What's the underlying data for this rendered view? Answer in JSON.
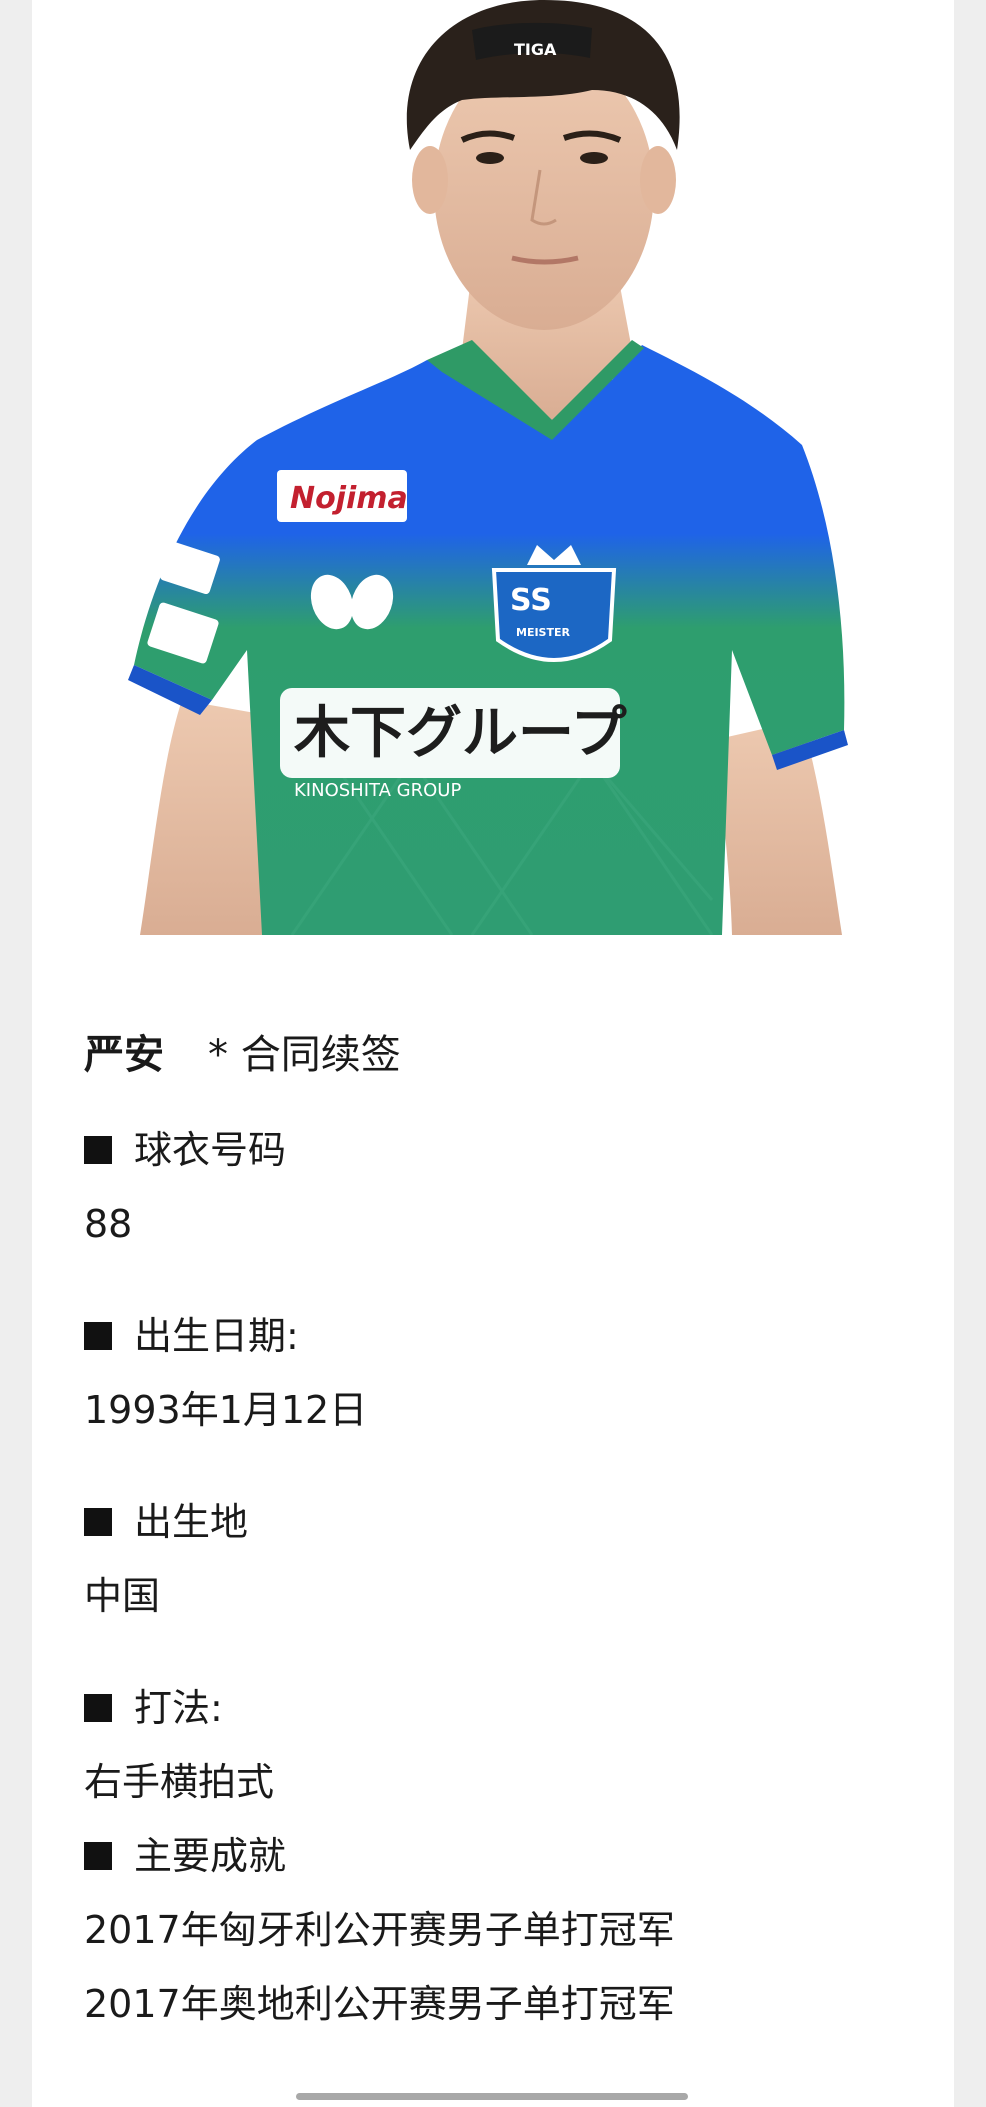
{
  "player": {
    "name": "严安",
    "note": "* 合同续签"
  },
  "sections": {
    "jersey": {
      "label": "球衣号码",
      "value": "88"
    },
    "birthdate": {
      "label": "出生日期:",
      "value": "1993年1月12日"
    },
    "birthplace": {
      "label": "出生地",
      "value": "中国"
    },
    "style": {
      "label": "打法:",
      "value": "右手横拍式"
    },
    "achievements": {
      "label": "主要成就",
      "items": [
        "2017年匈牙利公开赛男子单打冠军",
        "2017年奥地利公开赛男子单打冠军"
      ]
    }
  },
  "photo": {
    "jersey_sponsor": "Nojima",
    "jersey_main_text": "木下グループ",
    "jersey_sub_text": "KINOSHITA GROUP",
    "headband_text": "TIGA",
    "crest_text": "MEISTER",
    "colors": {
      "jersey_blue": "#1f63e8",
      "jersey_green": "#2e9e6e",
      "skin": "#e6c0a6",
      "hair": "#2a211b"
    }
  }
}
